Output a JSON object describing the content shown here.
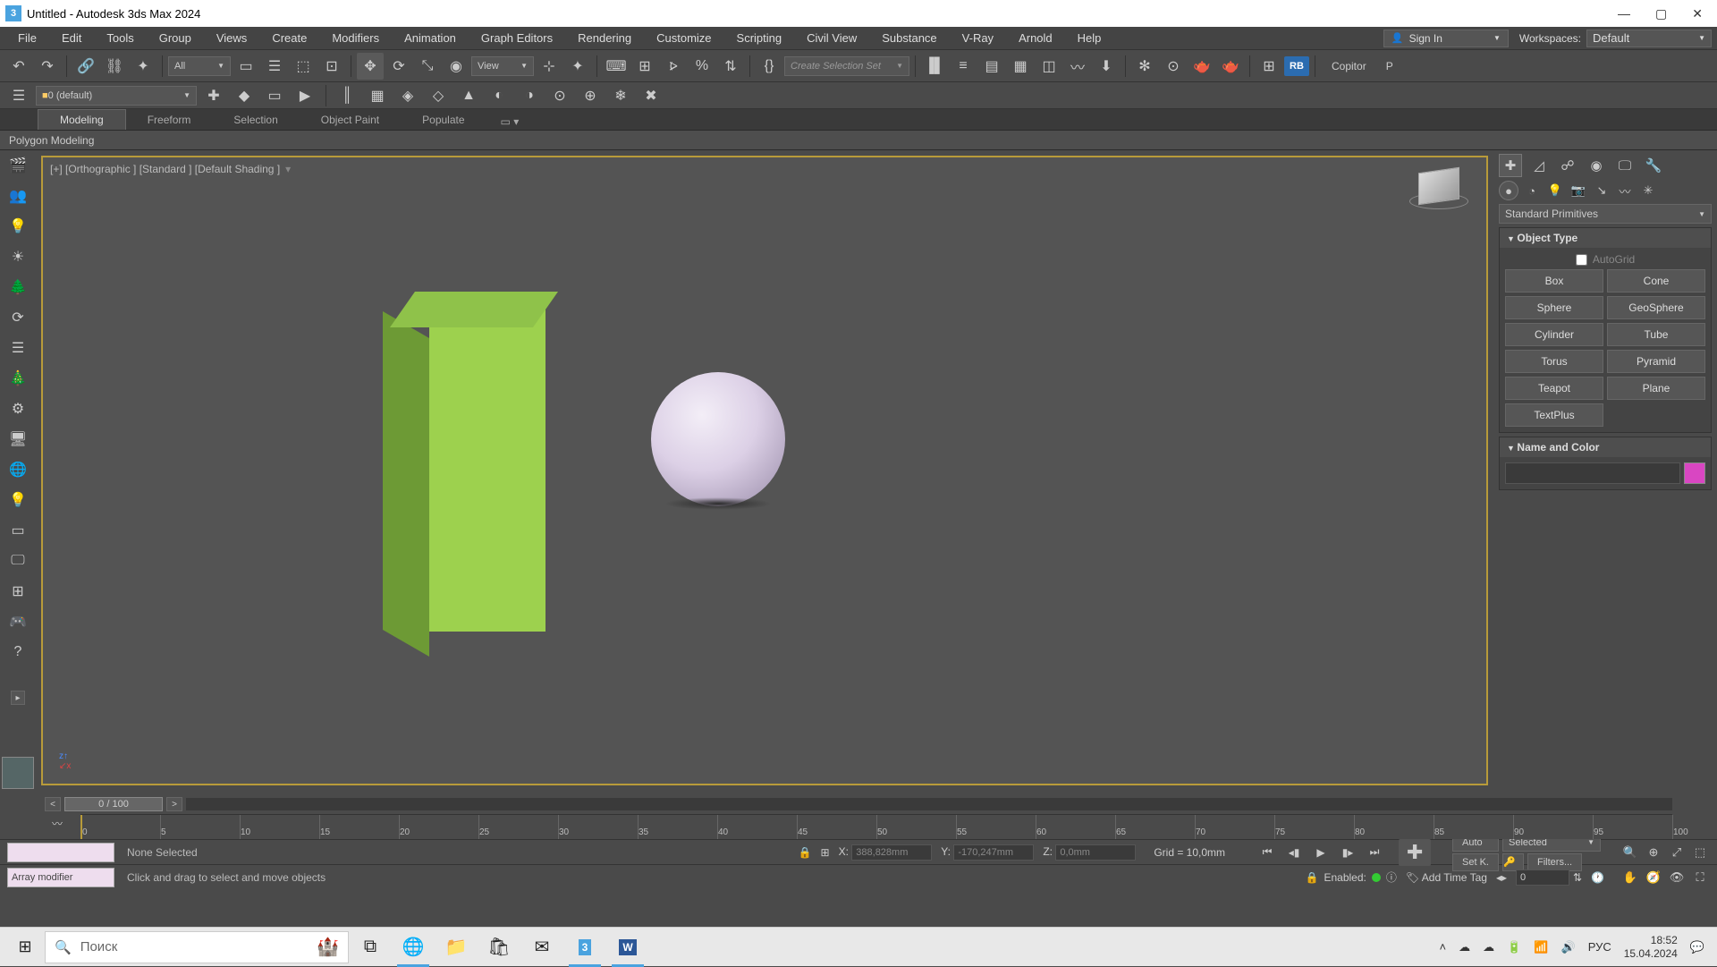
{
  "title": "Untitled - Autodesk 3ds Max 2024",
  "menu": [
    "File",
    "Edit",
    "Tools",
    "Group",
    "Views",
    "Create",
    "Modifiers",
    "Animation",
    "Graph Editors",
    "Rendering",
    "Customize",
    "Scripting",
    "Civil View",
    "Substance",
    "V-Ray",
    "Arnold",
    "Help"
  ],
  "signin": "Sign In",
  "workspace_label": "Workspaces:",
  "workspace_value": "Default",
  "toolbar": {
    "filter_all": "All",
    "view_label": "View",
    "selset_placeholder": "Create Selection Set",
    "rb": "RB",
    "copitor": "Copitor",
    "p": "P"
  },
  "layer": {
    "default": "0 (default)"
  },
  "ribbon": {
    "tabs": [
      "Modeling",
      "Freeform",
      "Selection",
      "Object Paint",
      "Populate"
    ],
    "active": 0,
    "sub": "Polygon Modeling"
  },
  "viewport": {
    "label": "[+] [Orthographic ] [Standard ] [Default Shading ]"
  },
  "cmd": {
    "category": "Standard Primitives",
    "rollout_objtype": "Object Type",
    "autogrid": "AutoGrid",
    "prims": [
      "Box",
      "Cone",
      "Sphere",
      "GeoSphere",
      "Cylinder",
      "Tube",
      "Torus",
      "Pyramid",
      "Teapot",
      "Plane",
      "TextPlus"
    ],
    "rollout_name": "Name and Color",
    "swatch": "#d946c2"
  },
  "timeline": {
    "handle": "0 / 100",
    "ticks": [
      0,
      5,
      10,
      15,
      20,
      25,
      30,
      35,
      40,
      45,
      50,
      55,
      60,
      65,
      70,
      75,
      80,
      85,
      90,
      95,
      100
    ]
  },
  "status": {
    "selection": "None Selected",
    "x_label": "X:",
    "x": "388,828mm",
    "y_label": "Y:",
    "y": "-170,247mm",
    "z_label": "Z:",
    "z": "0,0mm",
    "grid": "Grid = 10,0mm",
    "auto": "Auto",
    "setk": "Set K.",
    "selected": "Selected",
    "filters": "Filters...",
    "frame": "0"
  },
  "status2": {
    "mxs": "Array modifier",
    "prompt": "Click and drag to select and move objects",
    "enabled": "Enabled:",
    "addtag": "Add Time Tag"
  },
  "taskbar": {
    "search": "Поиск",
    "lang": "РУС",
    "time": "18:52",
    "date": "15.04.2024"
  }
}
